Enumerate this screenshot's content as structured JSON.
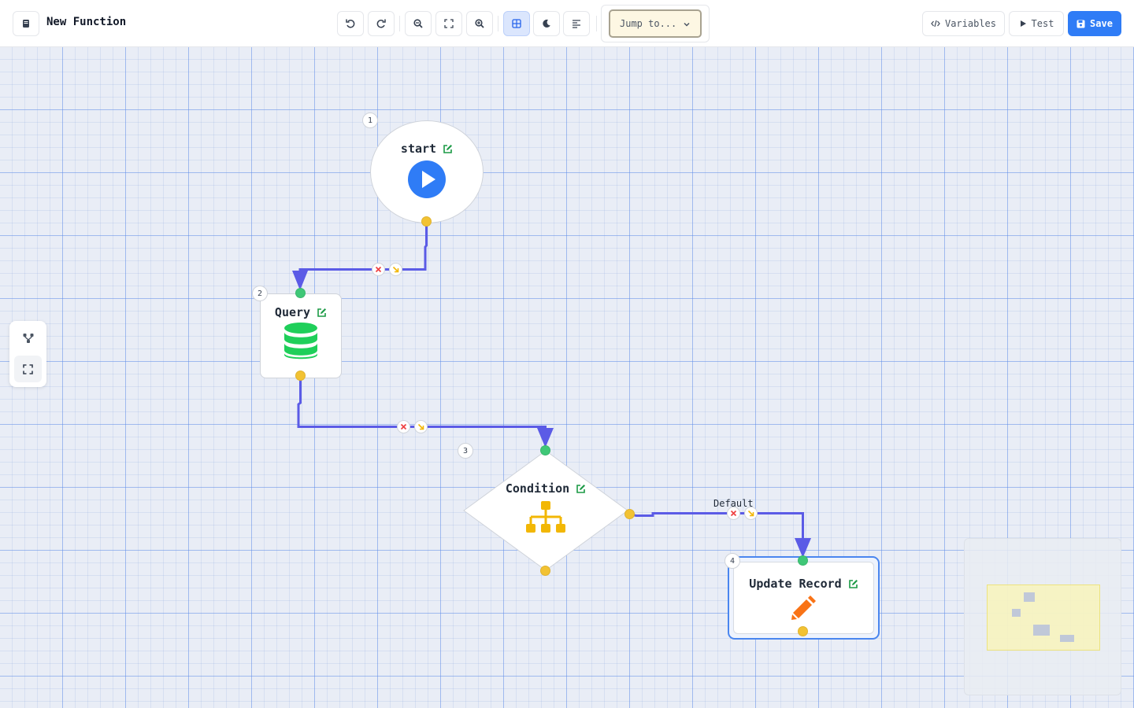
{
  "header": {
    "title": "New Function",
    "jump_placeholder": "Jump to...",
    "variables_label": "Variables",
    "test_label": "Test",
    "save_label": "Save"
  },
  "toolbar_icons": [
    "menu-icon",
    "undo-icon",
    "redo-icon",
    "zoom-out-icon",
    "fit-view-icon",
    "zoom-in-icon",
    "grid-icon",
    "moon-icon",
    "align-icon",
    "chevron-down-icon",
    "code-icon",
    "play-icon",
    "save-icon"
  ],
  "nodes": [
    {
      "number": "1",
      "label": "start",
      "type": "start",
      "icon": "play-circle-icon",
      "icon_color": "#2f7cf6"
    },
    {
      "number": "2",
      "label": "Query",
      "type": "query",
      "icon": "database-icon",
      "icon_color": "#1fcf5a"
    },
    {
      "number": "3",
      "label": "Condition",
      "type": "condition",
      "icon": "sitemap-icon",
      "icon_color": "#f2b705"
    },
    {
      "number": "4",
      "label": "Update Record",
      "type": "update",
      "icon": "pencil-icon",
      "icon_color": "#f97316"
    }
  ],
  "edges": [
    {
      "from": "1",
      "to": "2",
      "label": ""
    },
    {
      "from": "2",
      "to": "3",
      "label": ""
    },
    {
      "from": "3",
      "to": "4",
      "label": "Default"
    }
  ],
  "colors": {
    "edge": "#5b5be6",
    "accent": "#2f7cf6",
    "out_handle": "#f2c233",
    "in_handle": "#3fc777",
    "edit_icon": "#1b9a45"
  }
}
